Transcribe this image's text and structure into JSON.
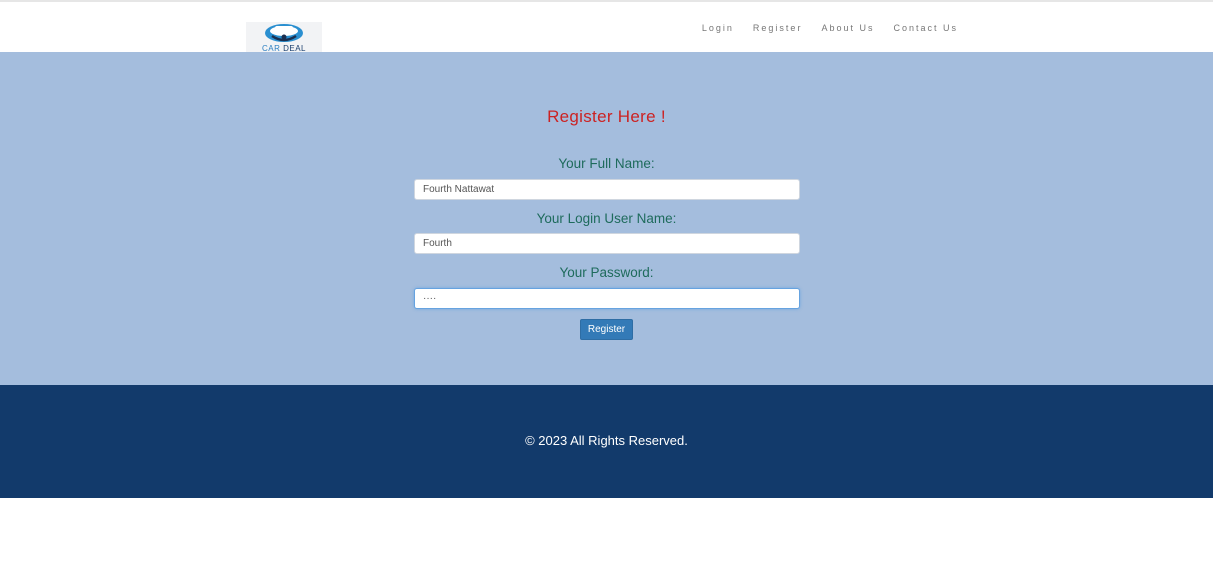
{
  "brand": {
    "logo_word_1": "CAR",
    "logo_word_2": "DEAL",
    "icon": "car-handshake-logo"
  },
  "nav": {
    "items": [
      {
        "label": "Login"
      },
      {
        "label": "Register"
      },
      {
        "label": "About Us"
      },
      {
        "label": "Contact Us"
      }
    ]
  },
  "form": {
    "title": "Register Here !",
    "full_name": {
      "label": "Your Full Name:",
      "value": "Fourth Nattawat"
    },
    "username": {
      "label": "Your Login User Name:",
      "value": "Fourth"
    },
    "password": {
      "label": "Your Password:",
      "value": "····"
    },
    "submit_label": "Register"
  },
  "footer": {
    "text": "© 2023 All Rights Reserved."
  },
  "colors": {
    "main_bg": "#a4bddd",
    "footer_bg": "#123a6b",
    "title": "#cc2222",
    "label": "#1e6b5c",
    "button": "#337ab7"
  }
}
